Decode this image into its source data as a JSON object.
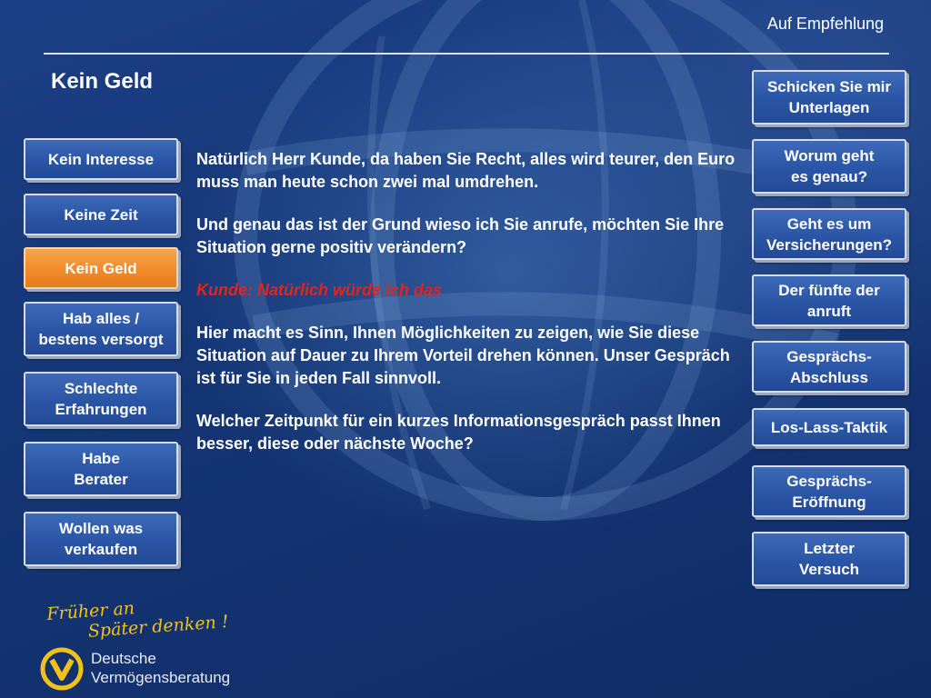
{
  "header": {
    "top_label": "Auf Empfehlung",
    "title": "Kein Geld"
  },
  "left_nav": [
    {
      "label": "Kein Interesse",
      "active": false
    },
    {
      "label": "Keine Zeit",
      "active": false
    },
    {
      "label": "Kein Geld",
      "active": true
    },
    {
      "label": "Hab alles /\nbestens versorgt",
      "active": false
    },
    {
      "label": "Schlechte\nErfahrungen",
      "active": false
    },
    {
      "label": "Habe\nBerater",
      "active": false
    },
    {
      "label": "Wollen was\nverkaufen",
      "active": false
    }
  ],
  "right_nav": [
    {
      "label": "Schicken Sie mir\nUnterlagen"
    },
    {
      "label": "Worum geht\nes genau?"
    },
    {
      "label": "Geht es um\nVersicherungen?"
    },
    {
      "label": "Der fünfte der\nanruft"
    },
    {
      "label": "Gesprächs-\nAbschluss"
    },
    {
      "label": "Los-Lass-Taktik"
    },
    {
      "label": "Gesprächs-\nEröffnung"
    },
    {
      "label": "Letzter\nVersuch"
    }
  ],
  "content": {
    "p1": "Natürlich Herr Kunde, da haben Sie Recht, alles wird teurer, den Euro muss man heute schon zwei mal umdrehen.",
    "p2": "Und genau das ist der Grund wieso ich Sie anrufe, möchten Sie Ihre Situation gerne positiv verändern?",
    "customer": "Kunde: Natürlich würde ich das",
    "p3": "Hier macht es Sinn, Ihnen Möglichkeiten zu zeigen, wie Sie diese Situation auf Dauer zu Ihrem Vorteil drehen können. Unser Gespräch ist für Sie in jeden Fall sinnvoll.",
    "p4": "Welcher Zeitpunkt für ein kurzes Informationsgespräch passt Ihnen besser, diese oder nächste Woche?"
  },
  "branding": {
    "slogan_line1": "Früher an",
    "slogan_line2": "Später denken !",
    "company_line1": "Deutsche",
    "company_line2": "Vermögensberatung",
    "logo_icon": "dvag-logo-icon"
  },
  "colors": {
    "active_button": "#ef8a2a",
    "button": "#2a55a6",
    "customer_text": "#e0251b",
    "slogan": "#f3c21a"
  }
}
